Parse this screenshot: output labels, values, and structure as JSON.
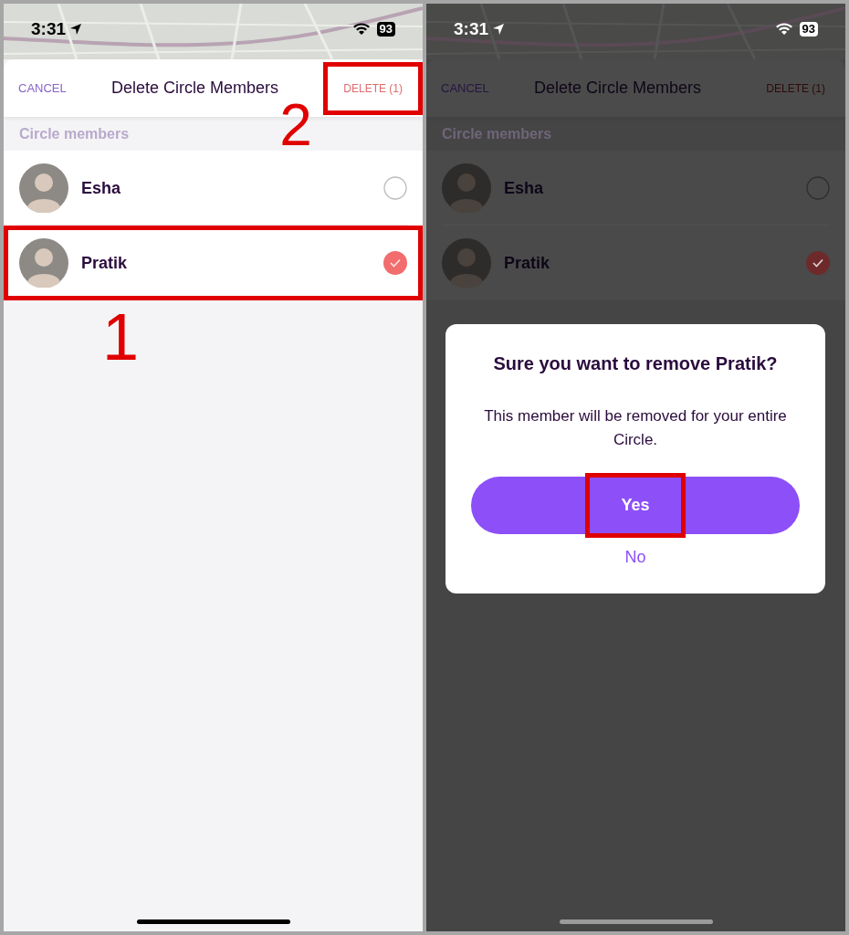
{
  "screens": [
    {
      "status_bar": {
        "time": "3:31",
        "battery": "93"
      },
      "header": {
        "cancel": "CANCEL",
        "title": "Delete Circle Members",
        "delete": {
          "text": "DELETE (1)",
          "highlighted": true,
          "callout": "2"
        }
      },
      "section_label": "Circle members",
      "members": [
        {
          "name": "Esha",
          "selected": false
        },
        {
          "name": "Pratik",
          "selected": true,
          "highlighted": true,
          "callout": "1"
        }
      ]
    },
    {
      "dimmed": true,
      "status_bar": {
        "time": "3:31",
        "battery": "93"
      },
      "header": {
        "cancel": "CANCEL",
        "title": "Delete Circle Members",
        "delete": {
          "text": "DELETE (1)"
        }
      },
      "section_label": "Circle members",
      "members": [
        {
          "name": "Esha",
          "selected": false
        },
        {
          "name": "Pratik",
          "selected": true
        }
      ],
      "dialog": {
        "title": "Sure you want to remove Pratik?",
        "message": "This member will be removed for your entire Circle.",
        "confirm": {
          "text": "Yes",
          "highlighted": true
        },
        "cancel": "No"
      }
    }
  ]
}
